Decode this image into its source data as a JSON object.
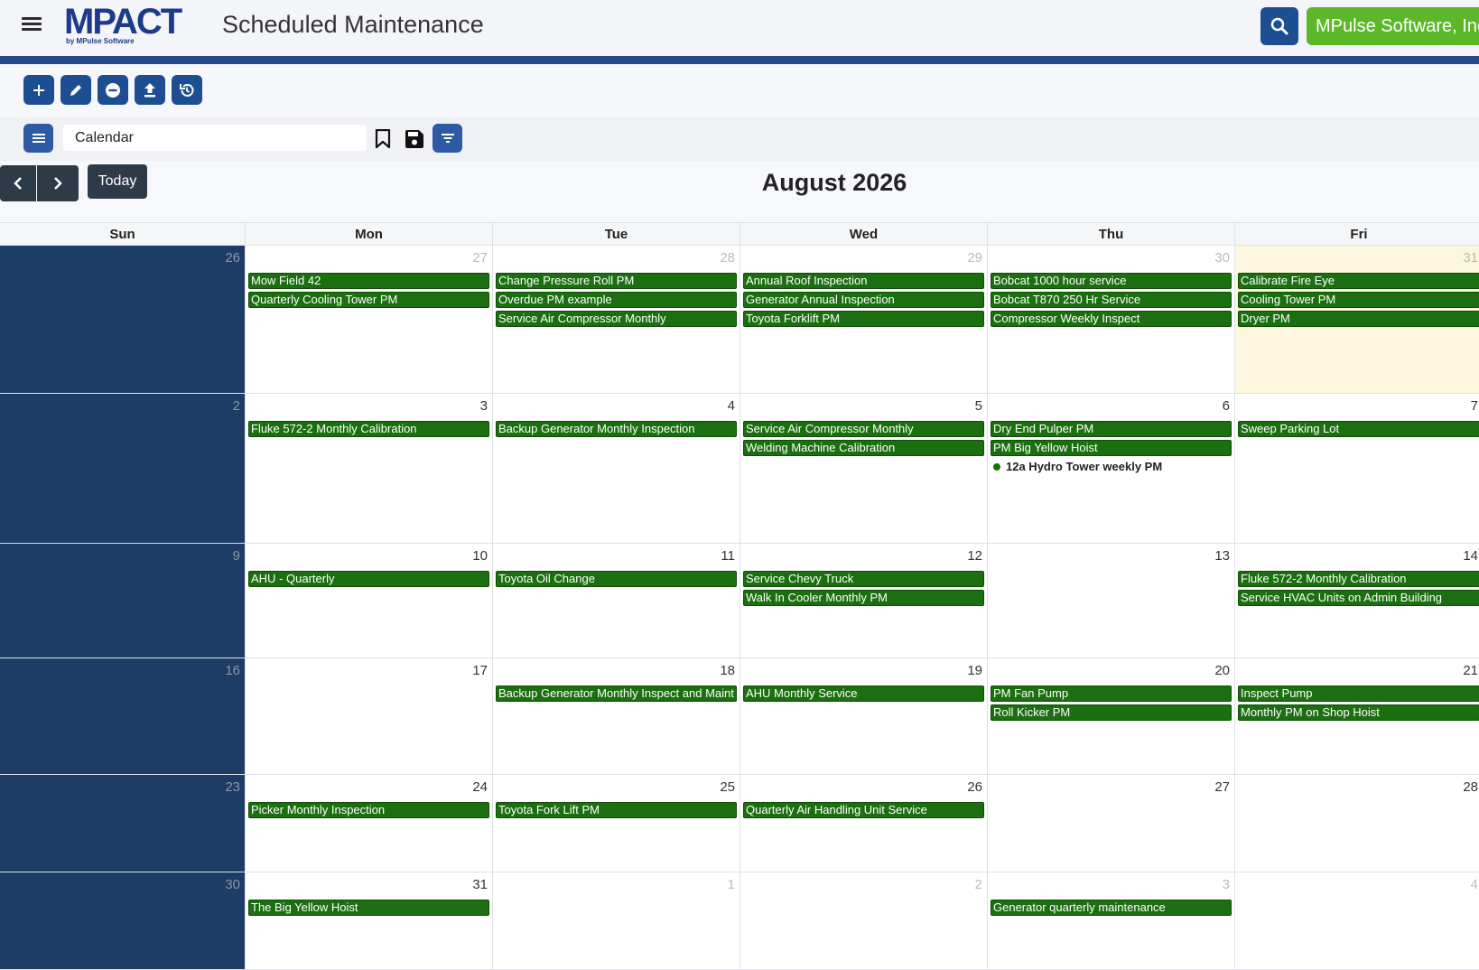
{
  "header": {
    "logo_text": "MPACT",
    "logo_sub": "by MPulse Software",
    "title": "Scheduled Maintenance",
    "company_label": "MPulse Software, Inc"
  },
  "toolbar": {
    "icons": [
      "plus-icon",
      "edit-icon",
      "minus-circle-icon",
      "upload-icon",
      "history-icon"
    ]
  },
  "viewbar": {
    "view_value": "Calendar"
  },
  "calendar": {
    "today_label": "Today",
    "month_title": "August 2026",
    "weekdays": [
      "Sun",
      "Mon",
      "Tue",
      "Wed",
      "Thu",
      "Fri"
    ],
    "weeks": [
      {
        "days": [
          {
            "num": "26",
            "other": true,
            "events": []
          },
          {
            "num": "27",
            "other": true,
            "events": [
              "Mow Field 42",
              "Quarterly Cooling Tower PM"
            ]
          },
          {
            "num": "28",
            "other": true,
            "events": [
              "Change Pressure Roll PM",
              "Overdue PM example",
              "Service Air Compressor Monthly"
            ]
          },
          {
            "num": "29",
            "other": true,
            "events": [
              "Annual Roof Inspection",
              "Generator Annual Inspection",
              "Toyota Forklift PM"
            ]
          },
          {
            "num": "30",
            "other": true,
            "events": [
              "Bobcat 1000 hour service",
              "Bobcat T870 250 Hr Service",
              "Compressor Weekly Inspect"
            ]
          },
          {
            "num": "31",
            "other": true,
            "today": true,
            "events": [
              "Calibrate Fire Eye",
              "Cooling Tower PM",
              "Dryer PM"
            ]
          }
        ]
      },
      {
        "days": [
          {
            "num": "2",
            "events": []
          },
          {
            "num": "3",
            "events": [
              "Fluke 572-2 Monthly Calibration"
            ]
          },
          {
            "num": "4",
            "events": [
              "Backup Generator Monthly Inspection"
            ]
          },
          {
            "num": "5",
            "events": [
              "Service Air Compressor Monthly",
              "Welding Machine Calibration"
            ]
          },
          {
            "num": "6",
            "events": [
              "Dry End Pulper PM",
              "PM Big Yellow Hoist"
            ],
            "dot_event": "12a Hydro Tower weekly PM"
          },
          {
            "num": "7",
            "events": [
              "Sweep Parking Lot"
            ]
          }
        ]
      },
      {
        "days": [
          {
            "num": "9",
            "events": []
          },
          {
            "num": "10",
            "events": [
              "AHU - Quarterly"
            ]
          },
          {
            "num": "11",
            "events": [
              "Toyota Oil Change"
            ]
          },
          {
            "num": "12",
            "events": [
              "Service Chevy Truck",
              "Walk In Cooler Monthly PM"
            ]
          },
          {
            "num": "13",
            "events": []
          },
          {
            "num": "14",
            "events": [
              "Fluke 572-2 Monthly Calibration",
              "Service HVAC Units on Admin Building"
            ]
          }
        ]
      },
      {
        "days": [
          {
            "num": "16",
            "events": []
          },
          {
            "num": "17",
            "events": []
          },
          {
            "num": "18",
            "events": [
              "Backup Generator Monthly Inspect and Maint"
            ]
          },
          {
            "num": "19",
            "events": [
              "AHU Monthly Service"
            ]
          },
          {
            "num": "20",
            "events": [
              "PM Fan Pump",
              "Roll Kicker PM"
            ]
          },
          {
            "num": "21",
            "events": [
              "Inspect Pump",
              "Monthly PM on Shop Hoist"
            ]
          }
        ]
      },
      {
        "days": [
          {
            "num": "23",
            "events": []
          },
          {
            "num": "24",
            "events": [
              "Picker Monthly Inspection"
            ]
          },
          {
            "num": "25",
            "events": [
              "Toyota Fork Lift PM"
            ]
          },
          {
            "num": "26",
            "events": [
              "Quarterly Air Handling Unit Service"
            ]
          },
          {
            "num": "27",
            "events": []
          },
          {
            "num": "28",
            "events": []
          }
        ]
      },
      {
        "days": [
          {
            "num": "30",
            "events": []
          },
          {
            "num": "31",
            "events": [
              "The Big Yellow Hoist"
            ]
          },
          {
            "num": "1",
            "other": true,
            "events": []
          },
          {
            "num": "2",
            "other": true,
            "events": []
          },
          {
            "num": "3",
            "other": true,
            "events": [
              "Generator quarterly maintenance"
            ]
          },
          {
            "num": "4",
            "other": true,
            "events": []
          }
        ]
      }
    ]
  },
  "colors": {
    "brand_blue": "#1e4e92",
    "accent_green": "#5cb82a",
    "event_green": "#1c6f10",
    "sunday_column": "#1d3c66",
    "today_highlight": "#fdf7dd"
  }
}
